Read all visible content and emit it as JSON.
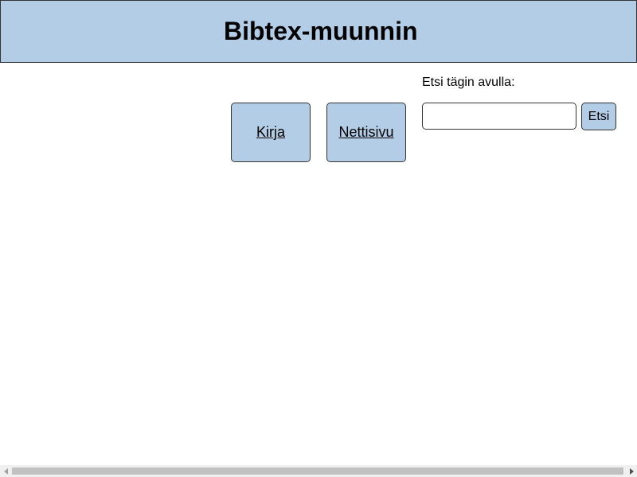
{
  "header": {
    "title": "Bibtex-muunnin"
  },
  "reference_types": [
    {
      "label": "Kirja"
    },
    {
      "label": "Nettisivu"
    }
  ],
  "search": {
    "label": "Etsi tägin avulla:",
    "value": "",
    "placeholder": "",
    "button_label": "Etsi"
  },
  "colors": {
    "header_background": "#b3cde6",
    "button_background": "#b3cde6",
    "border": "#333333"
  },
  "icons": {
    "scroll_left": "scroll-left-arrow-icon",
    "scroll_right": "scroll-right-arrow-icon"
  }
}
